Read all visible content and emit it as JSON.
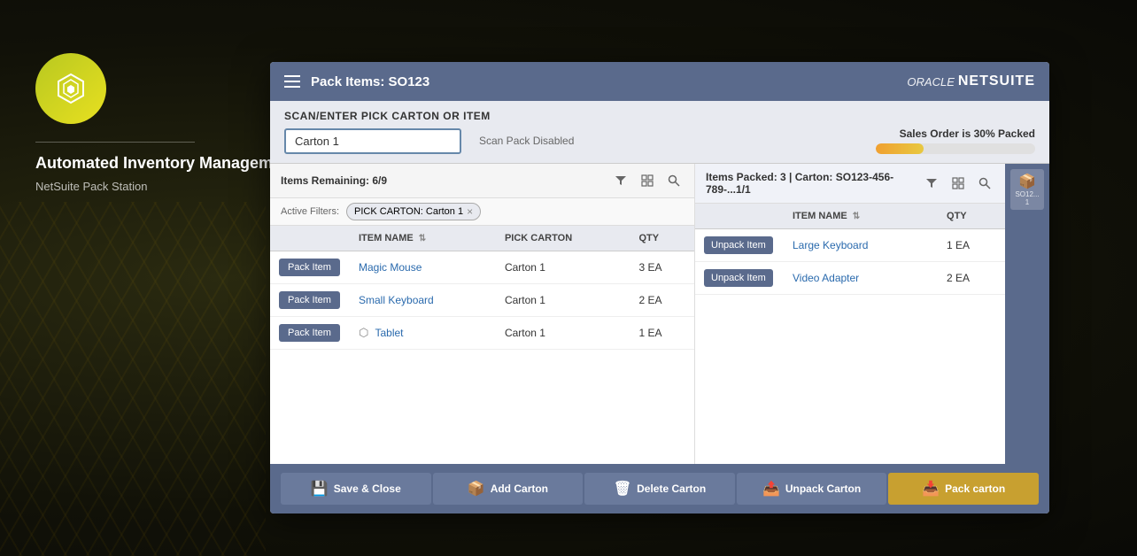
{
  "app": {
    "title": "Automated Inventory Management",
    "subtitle": "NetSuite Pack Station"
  },
  "logo": {
    "icon": "⬡",
    "oracle_label": "ORACLE",
    "netsuite_label": "NETSUITE"
  },
  "modal": {
    "title": "Pack Items: SO123",
    "scan_label": "SCAN/ENTER PICK CARTON OR ITEM",
    "scan_value": "Carton 1",
    "scan_placeholder": "Carton 1",
    "scan_disabled_text": "Scan Pack Disabled",
    "progress_label": "Sales Order is 30% Packed",
    "progress_pct": 30
  },
  "left_panel": {
    "items_remaining": "Items Remaining: 6/9",
    "active_filters_label": "Active Filters:",
    "filter_tag": "PICK CARTON: Carton 1",
    "columns": {
      "item_name": "ITEM NAME",
      "pick_carton": "PICK CARTON",
      "qty": "QTY"
    },
    "rows": [
      {
        "action": "Pack Item",
        "item": "Magic Mouse",
        "pick_carton": "Carton 1",
        "qty": "3 EA",
        "has_icon": false
      },
      {
        "action": "Pack Item",
        "item": "Small Keyboard",
        "pick_carton": "Carton 1",
        "qty": "2 EA",
        "has_icon": false
      },
      {
        "action": "Pack Item",
        "item": "Tablet",
        "pick_carton": "Carton 1",
        "qty": "1 EA",
        "has_icon": true
      }
    ]
  },
  "right_panel": {
    "items_packed": "Items Packed: 3 | Carton: SO123-456-789-...1/1",
    "columns": {
      "item_name": "ITEM NAME",
      "qty": "QTY"
    },
    "rows": [
      {
        "action": "Unpack Item",
        "item": "Large Keyboard",
        "qty": "1 EA"
      },
      {
        "action": "Unpack Item",
        "item": "Video Adapter",
        "qty": "2 EA"
      }
    ],
    "carton_thumb_label": "SO12...1"
  },
  "bottom_buttons": [
    {
      "id": "save-close",
      "label": "Save & Close",
      "icon": "💾",
      "accent": false
    },
    {
      "id": "add-carton",
      "label": "Add Carton",
      "icon": "📦",
      "accent": false
    },
    {
      "id": "delete-carton",
      "label": "Delete Carton",
      "icon": "🗑",
      "accent": false
    },
    {
      "id": "unpack-carton",
      "label": "Unpack Carton",
      "icon": "📤",
      "accent": false
    },
    {
      "id": "pack-carton",
      "label": "Pack carton",
      "icon": "📥",
      "accent": true
    }
  ]
}
